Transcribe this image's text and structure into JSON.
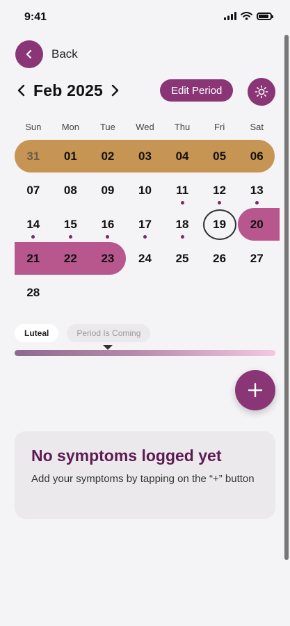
{
  "status": {
    "time": "9:41"
  },
  "nav": {
    "back_label": "Back"
  },
  "calendar": {
    "month_label": "Feb 2025",
    "edit_label": "Edit Period",
    "weekdays": [
      "Sun",
      "Mon",
      "Tue",
      "Wed",
      "Thu",
      "Fri",
      "Sat"
    ],
    "weeks": [
      [
        "31",
        "01",
        "02",
        "03",
        "04",
        "05",
        "06"
      ],
      [
        "07",
        "08",
        "09",
        "10",
        "11",
        "12",
        "13"
      ],
      [
        "14",
        "15",
        "16",
        "17",
        "18",
        "19",
        "20"
      ],
      [
        "21",
        "22",
        "23",
        "24",
        "25",
        "26",
        "27"
      ],
      [
        "28"
      ]
    ]
  },
  "phase": {
    "current_label": "Luteal",
    "next_label": "Period Is Coming"
  },
  "empty_state": {
    "title": "No symptoms logged yet",
    "body": "Add your symptoms by tapping on the “+” button"
  },
  "colors": {
    "accent": "#8a3576",
    "period": "#b8568e",
    "past_period": "#c69553",
    "title": "#5e1a53"
  }
}
